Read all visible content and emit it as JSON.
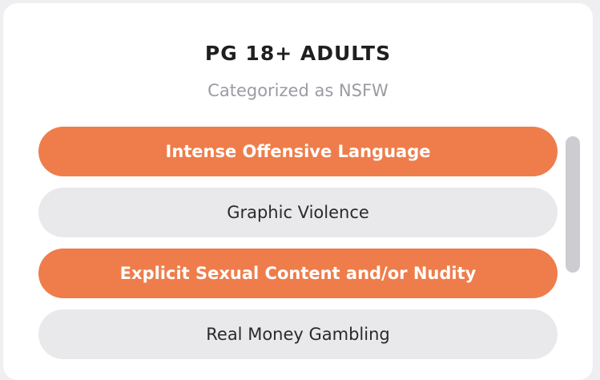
{
  "rating": {
    "title": "PG 18+ ADULTS",
    "subtitle": "Categorized as NSFW"
  },
  "options": [
    {
      "label": "Intense Offensive Language",
      "selected": true
    },
    {
      "label": "Graphic Violence",
      "selected": false
    },
    {
      "label": "Explicit Sexual Content and/or Nudity",
      "selected": true
    },
    {
      "label": "Real Money Gambling",
      "selected": false
    }
  ],
  "colors": {
    "accent": "#ee7d4b",
    "unselected_bg": "#e9e9ec",
    "card_bg": "#ffffff",
    "page_bg": "#efeff2"
  }
}
